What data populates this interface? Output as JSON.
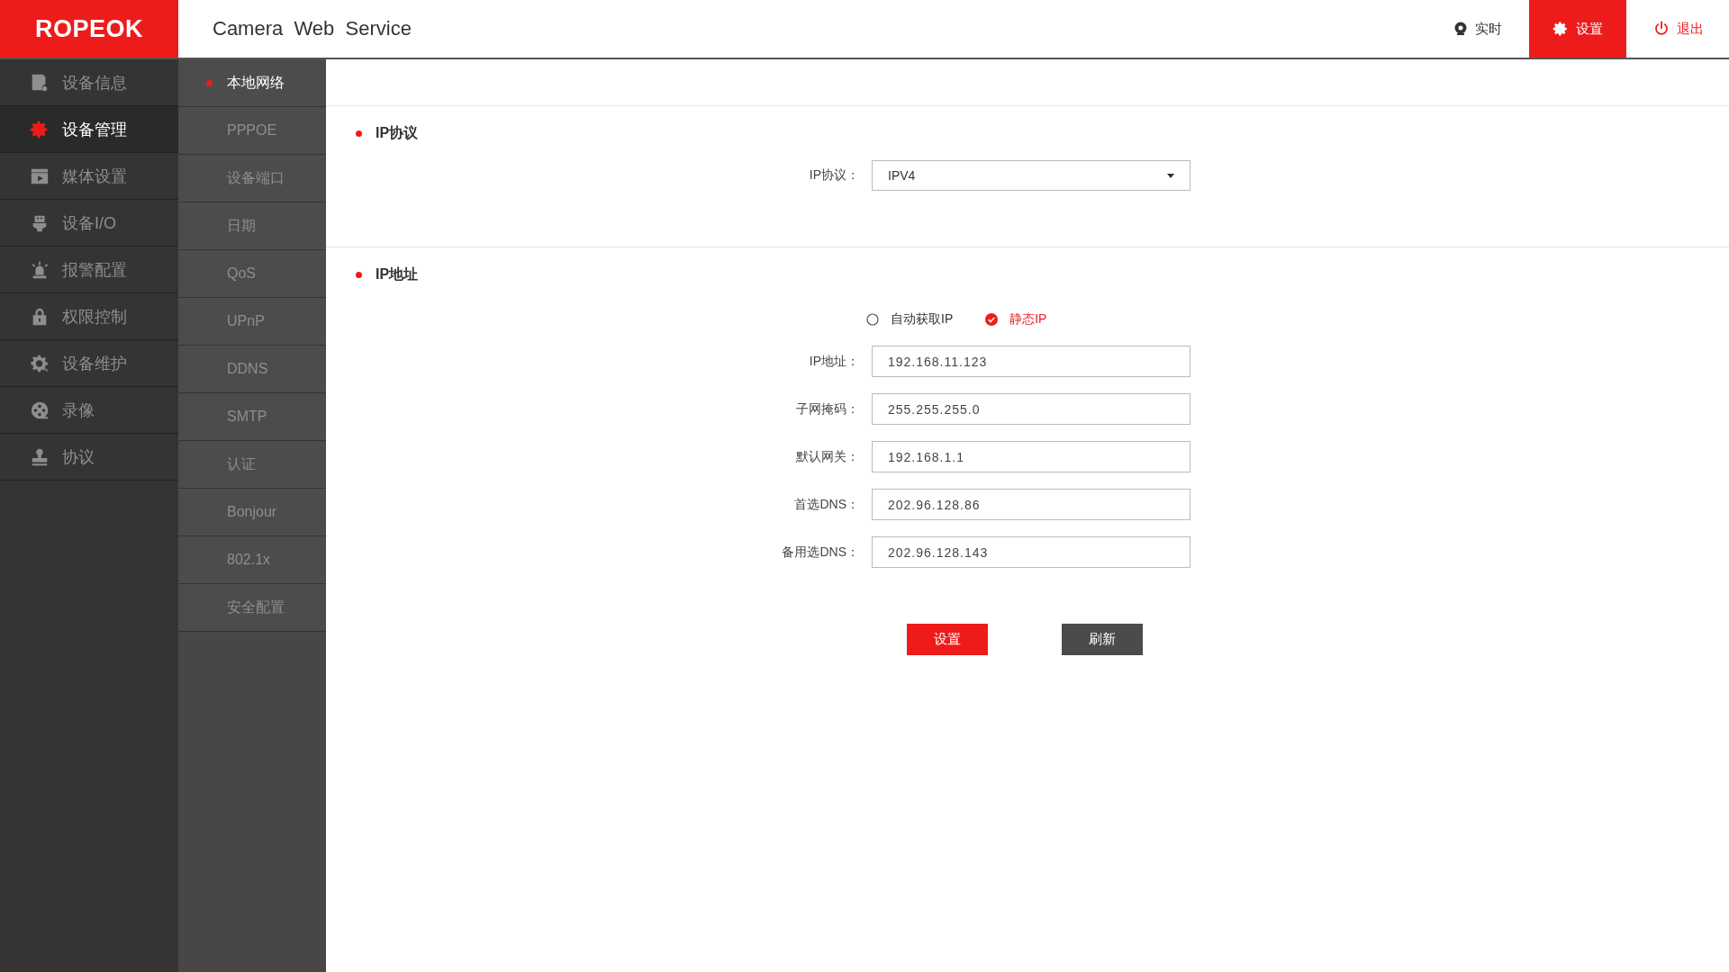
{
  "header": {
    "logo": "ROPEOK",
    "title": "Camera  Web  Service",
    "nav": [
      {
        "label": "实时",
        "selected": false,
        "kind": "normal"
      },
      {
        "label": "设置",
        "selected": true,
        "kind": "normal"
      },
      {
        "label": "退出",
        "selected": false,
        "kind": "danger"
      }
    ]
  },
  "sidebar": {
    "items": [
      {
        "label": "设备信息",
        "selected": false
      },
      {
        "label": "设备管理",
        "selected": true
      },
      {
        "label": "媒体设置",
        "selected": false
      },
      {
        "label": "设备I/O",
        "selected": false
      },
      {
        "label": "报警配置",
        "selected": false
      },
      {
        "label": "权限控制",
        "selected": false
      },
      {
        "label": "设备维护",
        "selected": false
      },
      {
        "label": "录像",
        "selected": false
      },
      {
        "label": "协议",
        "selected": false
      }
    ]
  },
  "submenu": {
    "items": [
      {
        "label": "本地网络",
        "selected": true
      },
      {
        "label": "PPPOE",
        "selected": false
      },
      {
        "label": "设备端口",
        "selected": false
      },
      {
        "label": "日期",
        "selected": false
      },
      {
        "label": "QoS",
        "selected": false
      },
      {
        "label": "UPnP",
        "selected": false
      },
      {
        "label": "DDNS",
        "selected": false
      },
      {
        "label": "SMTP",
        "selected": false
      },
      {
        "label": "认证",
        "selected": false
      },
      {
        "label": "Bonjour",
        "selected": false
      },
      {
        "label": "802.1x",
        "selected": false
      },
      {
        "label": "安全配置",
        "selected": false
      }
    ]
  },
  "protocol_section": {
    "title": "IP协议",
    "field": {
      "label": "IP协议：",
      "value": "IPV4"
    }
  },
  "address_section": {
    "title": "IP地址",
    "options": [
      {
        "label": "自动获取IP",
        "selected": false
      },
      {
        "label": "静态IP",
        "selected": true
      }
    ],
    "fields": [
      {
        "label": "IP地址：",
        "value": "192.168.11.123"
      },
      {
        "label": "子网掩码：",
        "value": "255.255.255.0"
      },
      {
        "label": "默认网关：",
        "value": "192.168.1.1"
      },
      {
        "label": "首选DNS：",
        "value": "202.96.128.86"
      },
      {
        "label": "备用选DNS：",
        "value": "202.96.128.143"
      }
    ]
  },
  "buttons": [
    {
      "label": "设置",
      "kind": "primary"
    },
    {
      "label": "刷新",
      "kind": "secondary"
    }
  ]
}
